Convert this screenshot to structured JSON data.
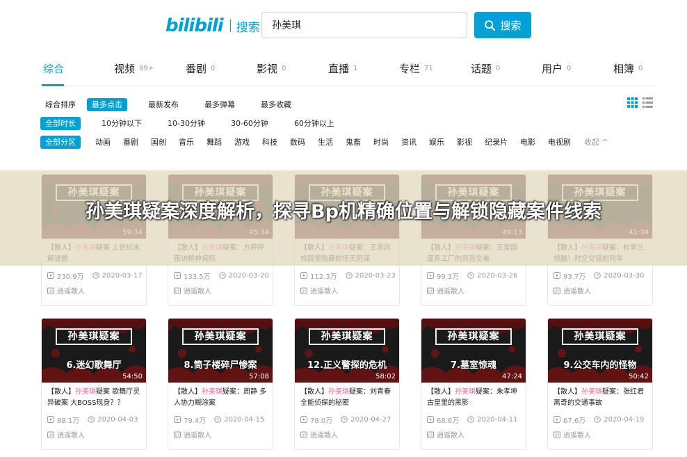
{
  "header": {
    "logo_text": "bilibili",
    "logo_section": "搜索",
    "search_value": "孙美琪",
    "search_button": "搜索",
    "search_icon": "search-icon"
  },
  "tabs": [
    {
      "label": "综合",
      "count": ""
    },
    {
      "label": "视频",
      "count": "99+"
    },
    {
      "label": "番剧",
      "count": "0"
    },
    {
      "label": "影视",
      "count": "0"
    },
    {
      "label": "直播",
      "count": "1"
    },
    {
      "label": "专栏",
      "count": "71"
    },
    {
      "label": "话题",
      "count": "0"
    },
    {
      "label": "用户",
      "count": "0"
    },
    {
      "label": "相簿",
      "count": "0"
    }
  ],
  "filters": {
    "sort": [
      "综合排序",
      "最多点击",
      "最新发布",
      "最多弹幕",
      "最多收藏"
    ],
    "duration": [
      "全部时长",
      "10分钟以下",
      "10-30分钟",
      "30-60分钟",
      "60分钟以上"
    ],
    "zone": [
      "全部分区",
      "动画",
      "番剧",
      "国创",
      "音乐",
      "舞蹈",
      "游戏",
      "科技",
      "数码",
      "生活",
      "鬼畜",
      "时尚",
      "资讯",
      "娱乐",
      "影视",
      "纪录片",
      "电影",
      "电视剧"
    ],
    "collapse_label": "收起 ^"
  },
  "colors": {
    "accent": "#00a1d6",
    "keyword": "#f25d8e",
    "overlay": "#e2dac2"
  },
  "cards": [
    {
      "plate": "孙美琪疑案",
      "episode": "",
      "duration": "59:34",
      "prefix": "【散人】",
      "kw": "孙美琪",
      "rest": "疑案 上世纪末解谜题",
      "views": "230.9万",
      "date": "2020-03-17",
      "author": "逍遥散人"
    },
    {
      "plate": "孙美琪疑案",
      "episode": "",
      "duration": "45:34",
      "prefix": "【散人】",
      "kw": "孙美琪",
      "rest": "疑案：方婷婷 夜访精神病院",
      "views": "133.5万",
      "date": "2020-03-20",
      "author": "逍遥散人"
    },
    {
      "plate": "孙美琪疑案",
      "episode": "",
      "duration": "",
      "prefix": "【散人】",
      "kw": "孙美琪",
      "rest": "疑案：王思凤 校园里隐藏的惊天阴谋",
      "views": "112.3万",
      "date": "2020-03-23",
      "author": "逍遥散人"
    },
    {
      "plate": "孙美琪疑案",
      "episode": "",
      "duration": "49:13",
      "prefix": "【散人】",
      "kw": "孙美琪",
      "rest": "疑案：王爱国 废弃工厂的邪恶交易",
      "views": "99.3万",
      "date": "2020-03-26",
      "author": "逍遥散人"
    },
    {
      "plate": "孙美琪疑案",
      "episode": "",
      "duration": "41:34",
      "prefix": "【散人】",
      "kw": "孙美琪",
      "rest": "疑案：杜翠兰 熄脑！时空交错的列车",
      "views": "93.7万",
      "date": "2020-03-30",
      "author": "逍遥散人"
    },
    {
      "plate": "孙美琪疑案",
      "episode": "6.迷幻歌舞厅",
      "duration": "54:50",
      "prefix": "【散人】",
      "kw": "孙美琪",
      "rest": "疑案 歌舞厅灵异破案 大BOSS现身？？",
      "views": "88.1万",
      "date": "2020-04-03",
      "author": "逍遥散人"
    },
    {
      "plate": "孙美琪疑案",
      "episode": "8.筒子楼碎尸惨案",
      "duration": "57:08",
      "prefix": "【散人】",
      "kw": "孙美琪",
      "rest": "疑案：周静 多人协力糊涂案",
      "views": "79.4万",
      "date": "2020-04-15",
      "author": "逍遥散人"
    },
    {
      "plate": "孙美琪疑案",
      "episode": "12.正义警探的危机",
      "duration": "58:02",
      "prefix": "【散人】",
      "kw": "孙美琪",
      "rest": "疑案：刘青春 全能侦探的秘密",
      "views": "78.0万",
      "date": "2020-04-27",
      "author": "逍遥散人"
    },
    {
      "plate": "孙美琪疑案",
      "episode": "7.墓室惊魂",
      "duration": "47:24",
      "prefix": "【散人】",
      "kw": "孙美琪",
      "rest": "疑案：朱孝坤 古皇里的黑影",
      "views": "68.6万",
      "date": "2020-04-11",
      "author": "逍遥散人"
    },
    {
      "plate": "孙美琪疑案",
      "episode": "9.公交车内的怪物",
      "duration": "50:42",
      "prefix": "【散人】",
      "kw": "孙美琪",
      "rest": "疑案：张红君 离奇的交通事故",
      "views": "67.6万",
      "date": "2020-04-19",
      "author": "逍遥散人"
    }
  ],
  "overlay_title": "孙美琪疑案深度解析，探寻Bp机精确位置与解锁隐藏案件线索"
}
